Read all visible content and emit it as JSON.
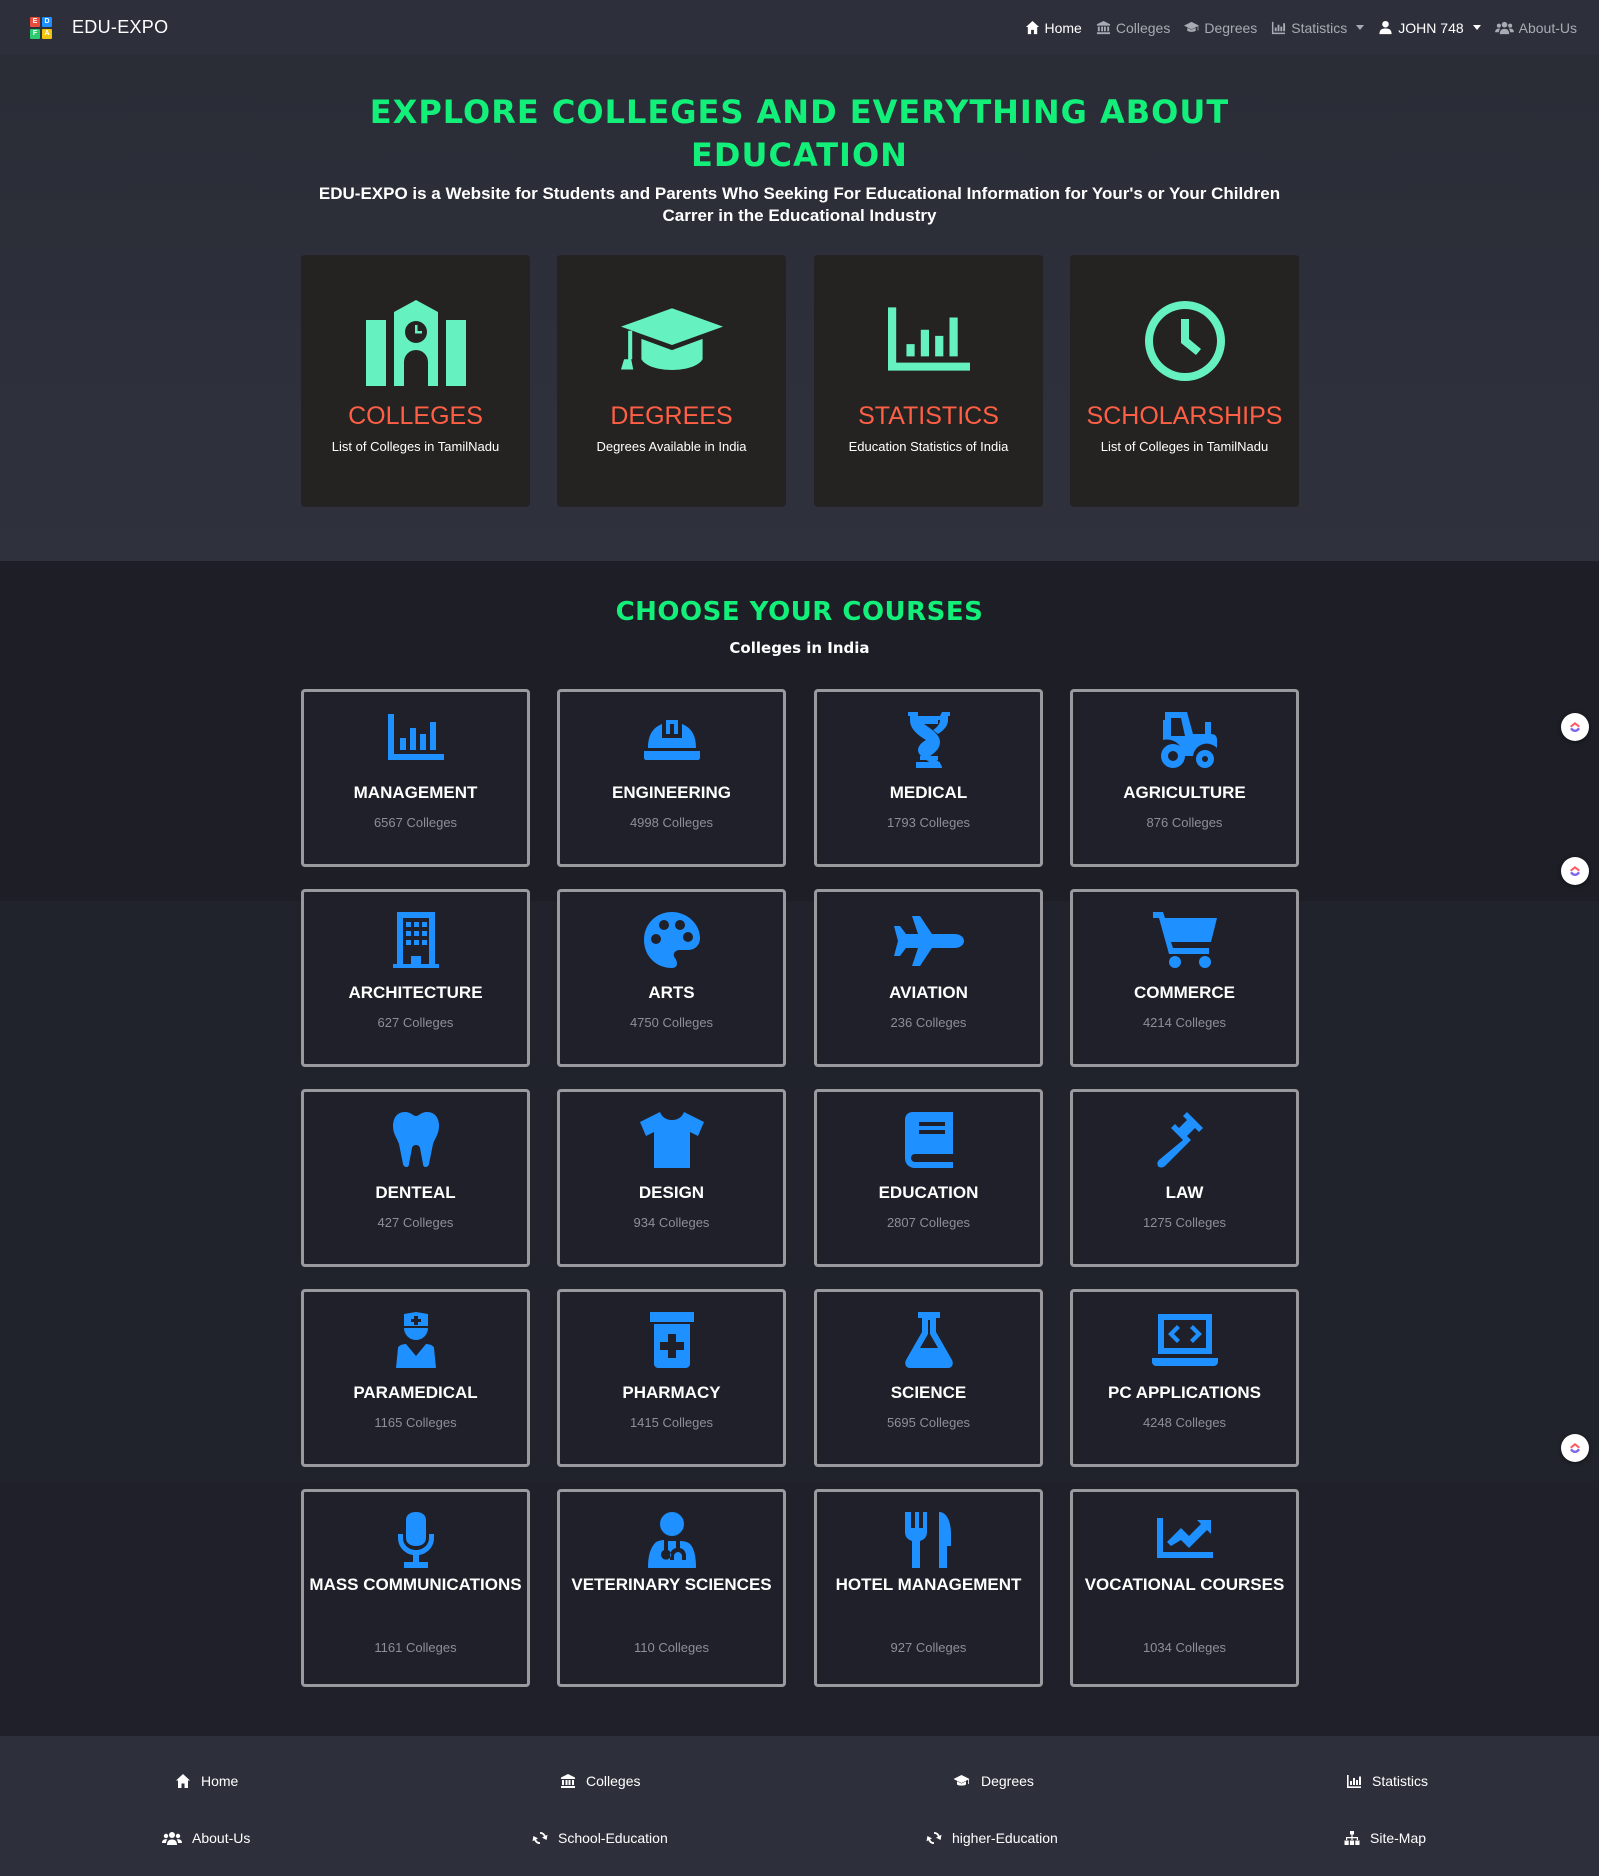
{
  "navbar": {
    "brand": "EDU-EXPO",
    "logo_letters": [
      "E",
      "D",
      "F",
      "A"
    ],
    "links": [
      {
        "label": "Home",
        "icon": "home-icon"
      },
      {
        "label": "Colleges",
        "icon": "university-icon"
      },
      {
        "label": "Degrees",
        "icon": "graduation-cap-icon"
      },
      {
        "label": "Statistics",
        "icon": "chart-bar-icon"
      },
      {
        "label": "JOHN 748",
        "icon": "user-icon"
      },
      {
        "label": "About-Us",
        "icon": "users-icon"
      }
    ]
  },
  "hero": {
    "title": "EXPLORE COLLEGES AND EVERYTHING ABOUT EDUCATION",
    "subtitle": "EDU-EXPO is a Website for Students and Parents Who Seeking For Educational Information for Your's or Your Children Carrer in the Educational Industry",
    "features": [
      {
        "title": "COLLEGES",
        "desc": "List of Colleges in TamilNadu",
        "icon": "school-icon"
      },
      {
        "title": "DEGREES",
        "desc": "Degrees Available in India",
        "icon": "graduation-cap-icon"
      },
      {
        "title": "STATISTICS",
        "desc": "Education Statistics of India",
        "icon": "chart-bar-icon"
      },
      {
        "title": "SCHOLARSHIPS",
        "desc": "List of Colleges in TamilNadu",
        "icon": "clock-icon"
      }
    ]
  },
  "courses": {
    "title": "CHOOSE YOUR COURSES",
    "subtitle": "Colleges in India",
    "items": [
      {
        "name": "MANAGEMENT",
        "count": "6567 Colleges",
        "icon": "chart-bar-icon"
      },
      {
        "name": "ENGINEERING",
        "count": "4998 Colleges",
        "icon": "hard-hat-icon"
      },
      {
        "name": "MEDICAL",
        "count": "1793 Colleges",
        "icon": "dna-icon"
      },
      {
        "name": "AGRICULTURE",
        "count": "876 Colleges",
        "icon": "tractor-icon"
      },
      {
        "name": "ARCHITECTURE",
        "count": "627 Colleges",
        "icon": "building-icon"
      },
      {
        "name": "ARTS",
        "count": "4750 Colleges",
        "icon": "palette-icon"
      },
      {
        "name": "AVIATION",
        "count": "236 Colleges",
        "icon": "plane-icon"
      },
      {
        "name": "COMMERCE",
        "count": "4214 Colleges",
        "icon": "shopping-cart-icon"
      },
      {
        "name": "DENTEAL",
        "count": "427 Colleges",
        "icon": "tooth-icon"
      },
      {
        "name": "DESIGN",
        "count": "934 Colleges",
        "icon": "tshirt-icon"
      },
      {
        "name": "EDUCATION",
        "count": "2807 Colleges",
        "icon": "book-icon"
      },
      {
        "name": "LAW",
        "count": "1275 Colleges",
        "icon": "gavel-icon"
      },
      {
        "name": "PARAMEDICAL",
        "count": "1165 Colleges",
        "icon": "user-nurse-icon"
      },
      {
        "name": "PHARMACY",
        "count": "1415 Colleges",
        "icon": "prescription-bottle-icon"
      },
      {
        "name": "SCIENCE",
        "count": "5695 Colleges",
        "icon": "flask-icon"
      },
      {
        "name": "PC APPLICATIONS",
        "count": "4248 Colleges",
        "icon": "laptop-code-icon"
      },
      {
        "name": "MASS COMMUNICATIONS",
        "count": "1161 Colleges",
        "icon": "microphone-icon"
      },
      {
        "name": "VETERINARY SCIENCES",
        "count": "110 Colleges",
        "icon": "user-doctor-icon"
      },
      {
        "name": "HOTEL MANAGEMENT",
        "count": "927 Colleges",
        "icon": "utensils-icon"
      },
      {
        "name": "VOCATIONAL COURSES",
        "count": "1034 Colleges",
        "icon": "chart-line-icon"
      }
    ]
  },
  "footer": {
    "links": [
      {
        "label": "Home",
        "icon": "home-icon"
      },
      {
        "label": "Colleges",
        "icon": "university-icon"
      },
      {
        "label": "Degrees",
        "icon": "graduation-cap-icon"
      },
      {
        "label": "Statistics",
        "icon": "chart-bar-icon"
      },
      {
        "label": "About-Us",
        "icon": "users-icon"
      },
      {
        "label": "School-Education",
        "icon": "sync-icon"
      },
      {
        "label": "higher-Education",
        "icon": "sync-icon"
      },
      {
        "label": "Site-Map",
        "icon": "sitemap-icon"
      }
    ]
  },
  "colors": {
    "accent_green": "#12f07a",
    "feature_icon": "#66f2c0",
    "feature_title": "#ff5f45",
    "course_icon": "#1e90ff"
  }
}
